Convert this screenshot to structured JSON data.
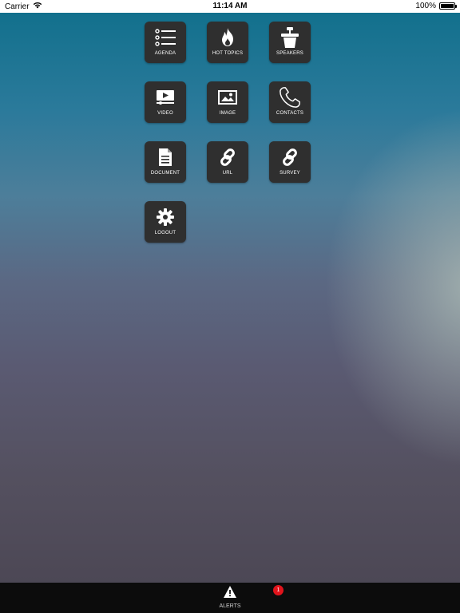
{
  "status_bar": {
    "carrier": "Carrier",
    "time": "11:14 AM",
    "battery": "100%",
    "wifi_icon": "wifi-icon",
    "battery_icon": "battery-icon"
  },
  "menu": {
    "tiles": [
      {
        "label": "AGENDA",
        "icon": "list-icon"
      },
      {
        "label": "HOT TOPICS",
        "icon": "flame-icon"
      },
      {
        "label": "SPEAKERS",
        "icon": "podium-icon"
      },
      {
        "label": "VIDEO",
        "icon": "video-icon"
      },
      {
        "label": "IMAGE",
        "icon": "image-icon"
      },
      {
        "label": "CONTACTS",
        "icon": "phone-icon"
      },
      {
        "label": "DOCUMENT",
        "icon": "document-icon"
      },
      {
        "label": "URL",
        "icon": "link-icon"
      },
      {
        "label": "SURVEY",
        "icon": "link-icon"
      },
      {
        "label": "LOGOUT",
        "icon": "gear-icon"
      }
    ]
  },
  "tab_bar": {
    "alerts_label": "ALERTS",
    "alerts_icon": "warning-icon",
    "alerts_badge": "1"
  },
  "colors": {
    "tile_bg": "#2f2f2f",
    "tab_bar_bg": "#0c0c0c",
    "badge": "#e1141c"
  }
}
